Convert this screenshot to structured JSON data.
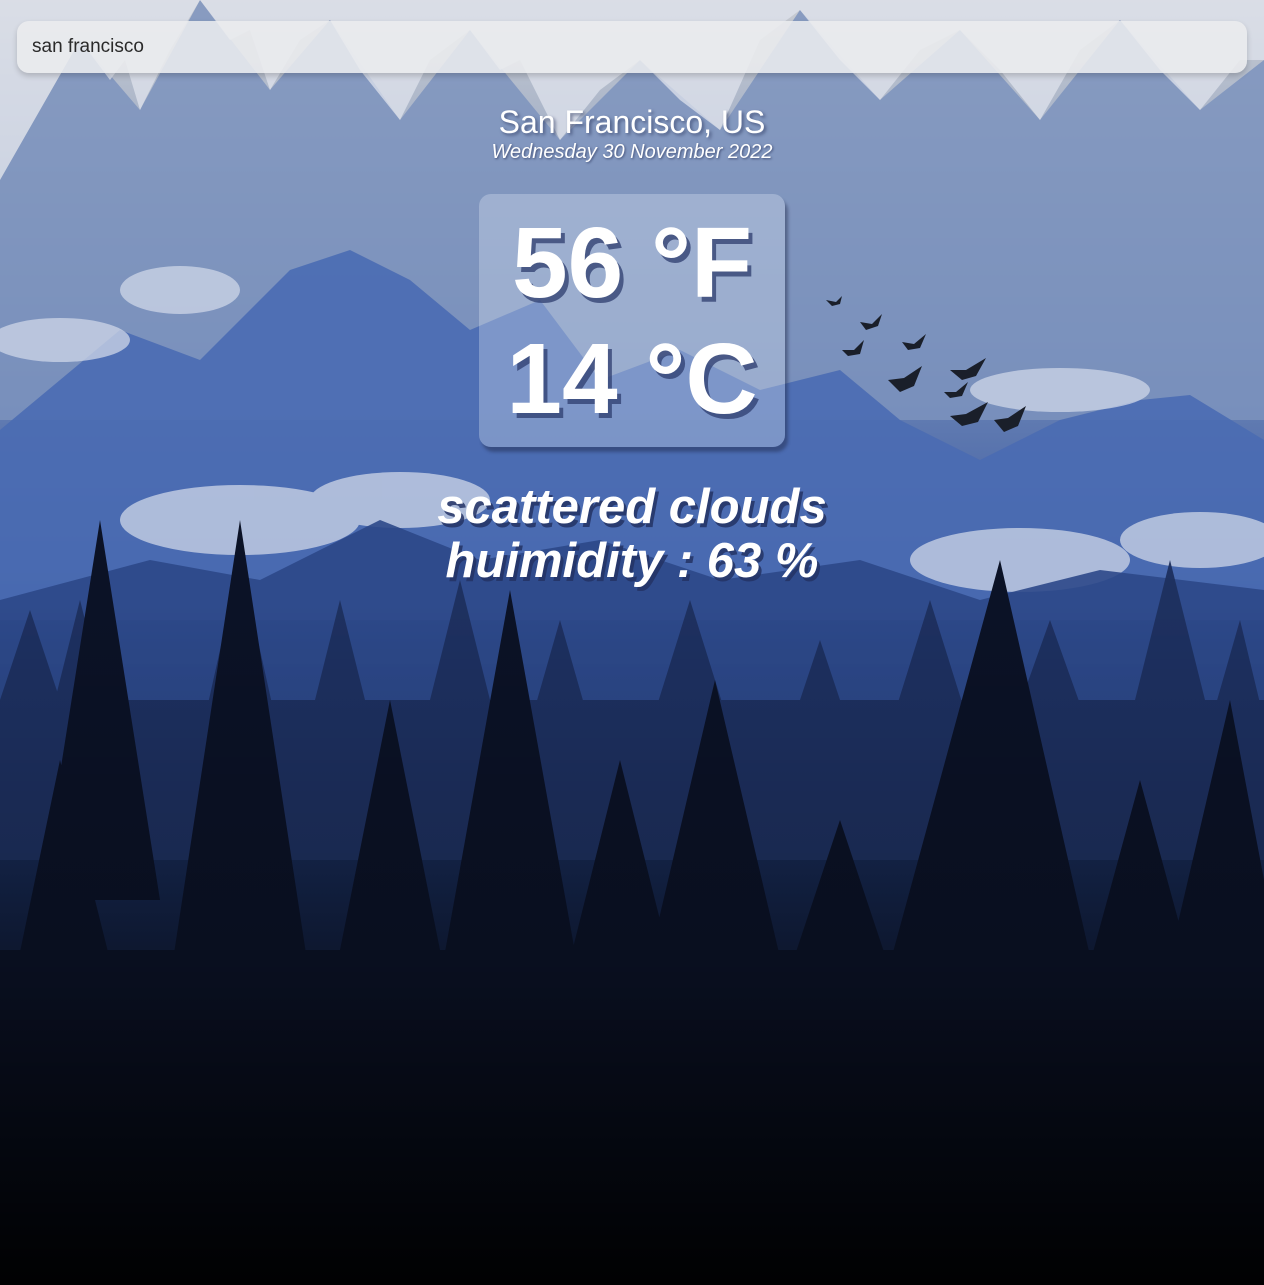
{
  "search": {
    "value": "san francisco"
  },
  "weather": {
    "location": "San Francisco, US",
    "date": "Wednesday 30 November 2022",
    "temp_f": "56 °F",
    "temp_c": "14 °C",
    "description": "scattered clouds",
    "humidity": "huimidity : 63 %"
  },
  "colors": {
    "text": "#ffffff",
    "search_bg": "#ebecee",
    "sky_top": "#c9ccd2",
    "mountain_blue": "#3f5da0",
    "forest_dark": "#05070d"
  },
  "background": {
    "scene": "mountains-forest-birds"
  }
}
